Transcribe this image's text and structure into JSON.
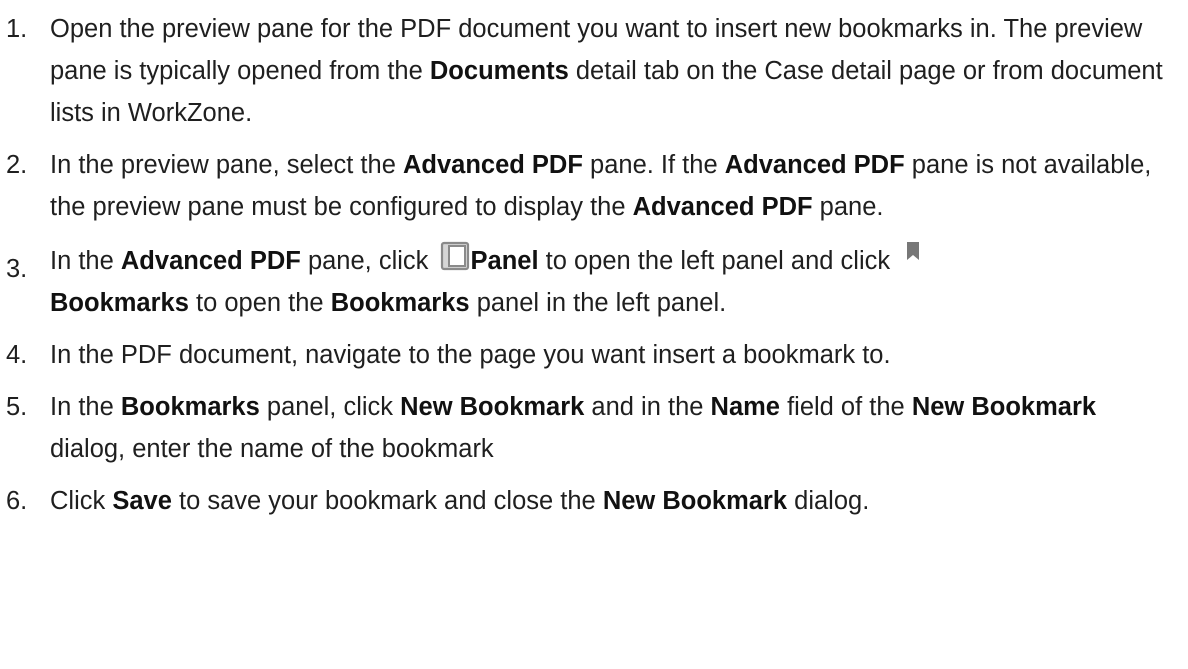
{
  "steps": [
    {
      "number": "1.",
      "parts": [
        {
          "t": "Open the preview pane for the PDF document you want to insert new bookmarks in. The preview pane is typically opened from the "
        },
        {
          "b": "Documents"
        },
        {
          "t": " detail tab on the Case detail page or from document lists in WorkZone."
        }
      ]
    },
    {
      "number": "2.",
      "parts": [
        {
          "t": "In the preview pane, select the "
        },
        {
          "b": "Advanced PDF"
        },
        {
          "t": " pane. If the "
        },
        {
          "b": "Advanced PDF"
        },
        {
          "t": " pane is not available, the preview pane must be configured to display the "
        },
        {
          "b": "Advanced PDF"
        },
        {
          "t": " pane."
        }
      ]
    },
    {
      "number": "3.",
      "parts": [
        {
          "t": "In the "
        },
        {
          "b": "Advanced PDF"
        },
        {
          "t": " pane, click "
        },
        {
          "icon": "panel-icon"
        },
        {
          "b": "Panel"
        },
        {
          "t": " to open the left panel and click "
        },
        {
          "icon": "bookmark-icon"
        },
        {
          "br": true
        },
        {
          "b": "Bookmarks"
        },
        {
          "t": " to open the "
        },
        {
          "b": "Bookmarks"
        },
        {
          "t": " panel in the left panel."
        }
      ]
    },
    {
      "number": "4.",
      "parts": [
        {
          "t": "In the PDF document, navigate to the page you want insert a bookmark to."
        }
      ]
    },
    {
      "number": "5.",
      "parts": [
        {
          "t": "In the "
        },
        {
          "b": "Bookmarks"
        },
        {
          "t": " panel, click "
        },
        {
          "b": "New Bookmark"
        },
        {
          "t": " and in the "
        },
        {
          "b": "Name"
        },
        {
          "t": " field of the "
        },
        {
          "b": "New Bookmark"
        },
        {
          "t": " dialog, enter the name of the bookmark"
        }
      ]
    },
    {
      "number": "6.",
      "parts": [
        {
          "t": "Click "
        },
        {
          "b": "Save"
        },
        {
          "t": " to save your bookmark and close the "
        },
        {
          "b": "New Bookmark"
        },
        {
          "t": " dialog."
        }
      ]
    }
  ],
  "icons": {
    "panel-icon": {
      "color": "#8a8a8a",
      "fill": "#d6d6d6"
    },
    "bookmark-icon": {
      "color": "#777777"
    }
  }
}
